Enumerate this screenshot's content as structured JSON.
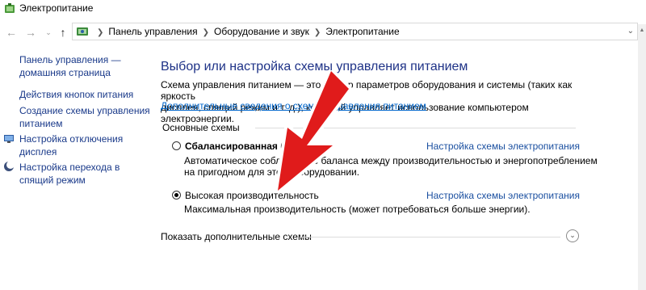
{
  "window": {
    "title": "Электропитание"
  },
  "navigation": {
    "back_icon": "back-arrow-icon",
    "forward_icon": "forward-arrow-icon",
    "history_icon": "chevron-down-icon",
    "up_icon": "up-arrow-icon",
    "breadcrumbs": [
      "Панель управления",
      "Оборудование и звук",
      "Электропитание"
    ]
  },
  "sidebar": {
    "items": [
      {
        "label_line1": "Панель управления —",
        "label_line2": "домашняя страница",
        "icon": ""
      },
      {
        "label_line1": "Действия кнопок питания",
        "label_line2": "",
        "icon": ""
      },
      {
        "label_line1": "Создание схемы управления",
        "label_line2": "питанием",
        "icon": ""
      },
      {
        "label_line1": "Настройка отключения",
        "label_line2": "дисплея",
        "icon": "display-icon"
      },
      {
        "label_line1": "Настройка перехода в",
        "label_line2": "спящий режим",
        "icon": "moon-icon"
      }
    ]
  },
  "main": {
    "heading": "Выбор или настройка схемы управления питанием",
    "description_line1": "Схема управления питанием — это на бор параметров оборудования и системы (таких как яркость",
    "description_line2": "дисплея, спящий режим и т. д.), кото рый управляет использование компьютером электроэнергии.",
    "more_info_link": "Дополнительные сведения о схемах управления питанием",
    "group_label": "Основные схемы",
    "plans": [
      {
        "name": "Сбалансированная (ре",
        "selected": false,
        "settings_link": "Настройка схемы электропитания",
        "desc_line1": "Автоматическое соблю дение баланса между производительностью и энергопотреблением",
        "desc_line2": "на пригодном для этого оборудовании."
      },
      {
        "name": "Высокая производительность",
        "selected": true,
        "settings_link": "Настройка схемы электропитания",
        "desc_line1": "Максимальная производительность (может потребоваться больше энергии).",
        "desc_line2": ""
      }
    ],
    "show_more_label": "Показать дополнительные схемы"
  },
  "overlay": {
    "arrow_color": "#e01b1b",
    "arrow_outline": "#ffffff"
  },
  "colors": {
    "heading": "#1e3287",
    "link": "#1a4fa0",
    "sidebar_link": "#1a3a8a"
  }
}
